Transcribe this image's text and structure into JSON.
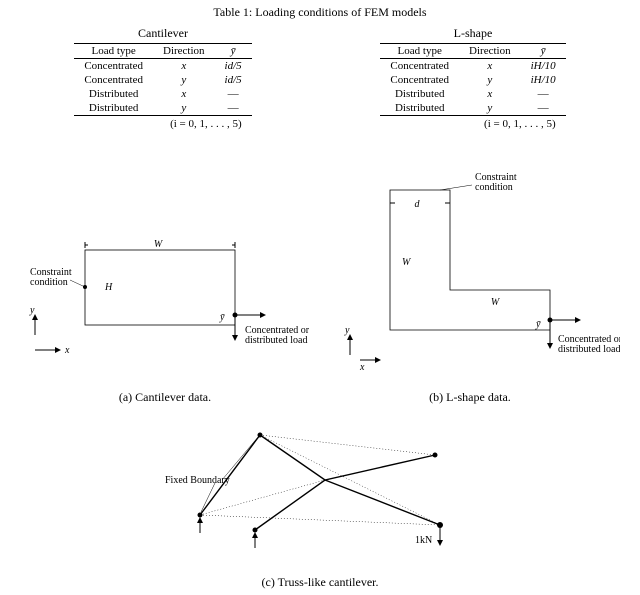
{
  "table_caption": "Table 1: Loading conditions of FEM models",
  "tables": [
    {
      "title": "Cantilever",
      "headers": [
        "Load type",
        "Direction",
        "ȳ"
      ],
      "rows": [
        [
          "Concentrated",
          "x",
          "id/5"
        ],
        [
          "Concentrated",
          "y",
          "id/5"
        ],
        [
          "Distributed",
          "x",
          "—"
        ],
        [
          "Distributed",
          "y",
          "—"
        ]
      ],
      "footnote": "(i = 0, 1, . . . , 5)"
    },
    {
      "title": "L-shape",
      "headers": [
        "Load type",
        "Direction",
        "ȳ"
      ],
      "rows": [
        [
          "Concentrated",
          "x",
          "iH/10"
        ],
        [
          "Concentrated",
          "y",
          "iH/10"
        ],
        [
          "Distributed",
          "x",
          "—"
        ],
        [
          "Distributed",
          "y",
          "—"
        ]
      ],
      "footnote": "(i = 0, 1, . . . , 5)"
    }
  ],
  "figA": {
    "caption": "(a) Cantilever data.",
    "labels": {
      "constraint": "Constraint",
      "condition": "condition",
      "W": "W",
      "H": "H",
      "ybar": "ȳ",
      "load1": "Concentrated or",
      "load2": "distributed load",
      "yaxis": "y",
      "xaxis": "x"
    }
  },
  "figB": {
    "caption": "(b) L-shape data.",
    "labels": {
      "constraint": "Constraint",
      "condition": "condition",
      "W": "W",
      "d": "d",
      "ybar": "ȳ",
      "load1": "Concentrated or",
      "load2": "distributed load",
      "yaxis": "y",
      "xaxis": "x"
    }
  },
  "figC": {
    "caption": "(c) Truss-like cantilever.",
    "labels": {
      "fixed": "Fixed Boundary",
      "load": "1kN"
    }
  }
}
